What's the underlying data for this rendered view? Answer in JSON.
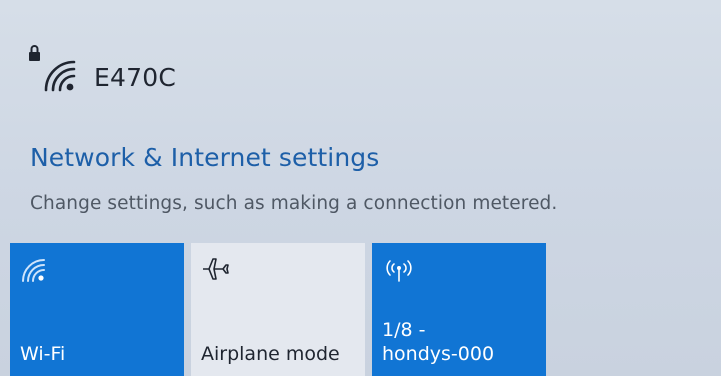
{
  "network": {
    "name": "E470C",
    "icon": "wifi-secured-icon"
  },
  "settings": {
    "link_label": "Network & Internet settings",
    "description": "Change settings, such as making a connection metered."
  },
  "tiles": [
    {
      "label": "Wi-Fi",
      "icon": "wifi-icon",
      "state": "on"
    },
    {
      "label": "Airplane mode",
      "icon": "airplane-icon",
      "state": "off"
    },
    {
      "label": "1/8 -\nhondys-000",
      "icon": "mobile-hotspot-icon",
      "state": "on"
    }
  ],
  "colors": {
    "accent": "#1175d4",
    "link": "#1d5fa8",
    "tile_off": "#e4e8ef",
    "background": "#cfd8e4"
  }
}
